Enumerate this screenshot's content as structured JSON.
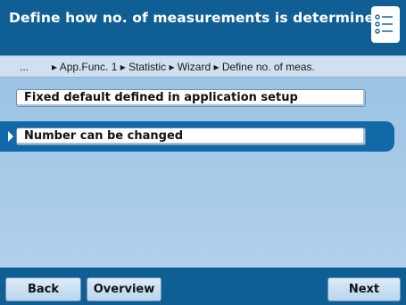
{
  "header": {
    "title": "Define how no. of measurements is determined",
    "menu_icon": "list-icon",
    "colors": {
      "header_bg": "#0f5f94",
      "content_bg": "#a8cbe8",
      "selected_band": "#1169a8"
    }
  },
  "breadcrumb": {
    "ellipsis": "...",
    "path": "▸ App.Func. 1 ▸ Statistic ▸ Wizard ▸ Define no. of meas."
  },
  "options": [
    {
      "label": "Fixed default defined in application setup",
      "selected": false
    },
    {
      "label": "Number can be changed",
      "selected": true
    }
  ],
  "footer": {
    "back_label": "Back",
    "overview_label": "Overview",
    "next_label": "Next"
  }
}
